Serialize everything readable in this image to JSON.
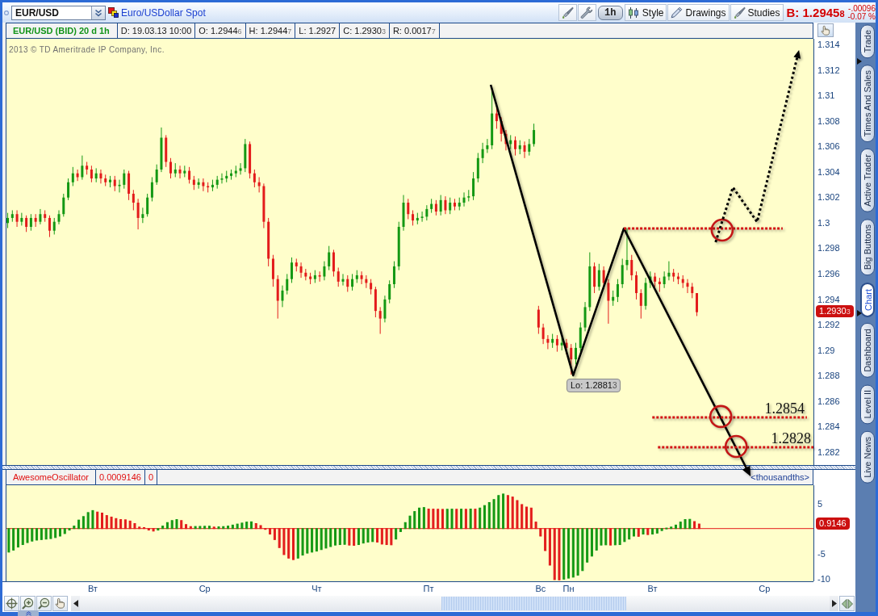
{
  "toolbar": {
    "symbol": "EUR/USD",
    "description": "Euro/USDollar Spot",
    "buttons": [
      {
        "kind": "interval",
        "label": "1h"
      },
      {
        "kind": "menu",
        "label": "Style"
      },
      {
        "kind": "menu",
        "label": "Drawings"
      },
      {
        "kind": "menu",
        "label": "Studies"
      }
    ],
    "bid": {
      "text": "B: 1.2945",
      "pipette": "8"
    },
    "change": "-.00096",
    "change_percent": "-0.07 %"
  },
  "price_panel": {
    "header": [
      {
        "kind": "title",
        "text": "EUR/USD (BID) 20 d 1h"
      },
      {
        "kind": "field",
        "text": "D: 19.03.13 10:00"
      },
      {
        "kind": "field",
        "text": "O: 1.2944",
        "pipette": "6"
      },
      {
        "kind": "field",
        "text": "H: 1.2944",
        "pipette": "7"
      },
      {
        "kind": "field",
        "text": "L: 1.2927"
      },
      {
        "kind": "field",
        "text": "C: 1.2930",
        "pipette": "3"
      },
      {
        "kind": "field",
        "text": "R: 0.0017",
        "pipette": "7"
      }
    ],
    "copyright": "2013 © TD Ameritrade IP Company, Inc.",
    "price_axis": [
      "1.314",
      "1.312",
      "1.31",
      "1.308",
      "1.306",
      "1.304",
      "1.302",
      "1.3",
      "1.298",
      "1.296",
      "1.294",
      "1.292",
      "1.29",
      "1.288",
      "1.286",
      "1.284",
      "1.282"
    ],
    "last_price": {
      "text": "1.2930",
      "pipette": "3"
    },
    "low_label": {
      "text": "Lo: 1.2881",
      "pipette": "3"
    },
    "level_labels": [
      "1.2854",
      "1.2828"
    ]
  },
  "oscillator_panel": {
    "values": [
      "0.0009146",
      "0"
    ],
    "units": "<thousandths>",
    "last_value": "0.9146",
    "chart_data": {
      "type": "bar",
      "categories": [
        null,
        null,
        null,
        null,
        null,
        null,
        null,
        null,
        null,
        null,
        null,
        null,
        null,
        null,
        null,
        null,
        null,
        null,
        "Вт",
        null,
        null,
        null,
        null,
        null,
        null,
        null,
        null,
        null,
        null,
        null,
        null,
        null,
        null,
        null,
        null,
        null,
        null,
        null,
        null,
        null,
        null,
        null,
        "Ср",
        null,
        null,
        null,
        null,
        null,
        null,
        null,
        null,
        null,
        null,
        null,
        null,
        null,
        null,
        null,
        null,
        null,
        null,
        null,
        null,
        null,
        null,
        null,
        "Чт",
        null,
        null,
        null,
        null,
        null,
        null,
        null,
        null,
        null,
        null,
        null,
        null,
        null,
        null,
        null,
        null,
        null,
        null,
        null,
        null,
        null,
        null,
        null,
        "Пт",
        null,
        null,
        null,
        null,
        null,
        null,
        null,
        null,
        null,
        null,
        null,
        null,
        null,
        null,
        null,
        null,
        null,
        null,
        null,
        null,
        null,
        null,
        null,
        "Вс",
        null,
        null,
        null,
        null,
        null,
        "Пн",
        null,
        null,
        null,
        null,
        null,
        null,
        null,
        null,
        null,
        null,
        null,
        null,
        null,
        null,
        null,
        null,
        null,
        "Вт",
        null,
        null,
        null,
        null,
        null,
        null,
        null,
        null,
        null,
        null,
        null,
        null,
        null,
        null,
        null,
        null,
        null,
        null,
        null,
        null,
        null,
        null,
        null,
        "Ср",
        null,
        null,
        null,
        null,
        null,
        null,
        null,
        null,
        null,
        null
      ],
      "ylim": [
        -10.53,
        8.66
      ],
      "yticks": [
        5,
        -5,
        -10
      ],
      "ref_lines": [
        {
          "axis": "y",
          "value": 0
        }
      ],
      "series": [
        {
          "name": "AwesomeOscillator",
          "values": [
            -4.7,
            -4.3,
            -3.7,
            -3.2,
            -2.8,
            -2.5,
            -2.3,
            -2.2,
            -2.1,
            -2.0,
            -1.8,
            -1.5,
            -1.0,
            -0.3,
            0.5,
            1.7,
            2.4,
            3.2,
            3.6,
            3.3,
            3.1,
            2.6,
            2.3,
            2.0,
            1.8,
            1.75,
            1.5,
            1.0,
            0.3,
            0.2,
            -0.3,
            -0.5,
            -0.3,
            0.5,
            1.2,
            1.6,
            1.8,
            1.6,
            0.8,
            0.4,
            0.42,
            0.44,
            0.46,
            0.48,
            0.3,
            0.35,
            0.4,
            0.5,
            0.7,
            0.9,
            1.1,
            1.3,
            1.35,
            1.0,
            0.6,
            0.0,
            -1.1,
            -2.2,
            -3.8,
            -5.2,
            -5.9,
            -6.2,
            -5.9,
            -5.3,
            -4.9,
            -4.7,
            -4.5,
            -4.2,
            -3.9,
            -3.6,
            -3.3,
            -3.2,
            -3.15,
            -3.3,
            -3.35,
            -3.2,
            -2.9,
            -2.7,
            -2.6,
            -2.7,
            -3.1,
            -3.2,
            -3.25,
            -2.1,
            -0.6,
            1.2,
            2.5,
            3.4,
            4.1,
            4.2,
            3.9,
            3.88,
            3.86,
            3.84,
            3.86,
            3.88,
            3.86,
            3.88,
            3.86,
            3.9,
            3.88,
            4.1,
            4.6,
            5.2,
            5.8,
            6.6,
            6.9,
            6.6,
            6.3,
            5.6,
            4.8,
            4.3,
            4.1,
            1.3,
            -1.5,
            -4.4,
            -7.3,
            -10.2,
            -10.25,
            -10.1,
            -9.9,
            -9.7,
            -9.3,
            -8.4,
            -6.7,
            -5.5,
            -4.3,
            -3.3,
            -3.25,
            -3.3,
            -3.25,
            -3.2,
            -2.6,
            -2.1,
            -1.5,
            -1.55,
            -1.1,
            -1.2,
            -1.1,
            -0.9,
            -0.4,
            0.1,
            0.3,
            0.7,
            1.3,
            1.8,
            1.85,
            1.4,
            0.91,
            null,
            null,
            null,
            null,
            null,
            null,
            null,
            null,
            null,
            null,
            null,
            null,
            null,
            null,
            null,
            null,
            null,
            null,
            null,
            null,
            null,
            null,
            null,
            null
          ]
        }
      ]
    }
  },
  "side_tabs": [
    {
      "label": "Trade",
      "selected": false
    },
    {
      "label": "Times And Sales",
      "selected": false
    },
    {
      "label": "Active Trader",
      "selected": false
    },
    {
      "label": "Big Buttons",
      "selected": false
    },
    {
      "label": "Chart",
      "selected": true
    },
    {
      "label": "Dashboard",
      "selected": false
    },
    {
      "label": "Level II",
      "selected": false
    },
    {
      "label": "Live News",
      "selected": false
    }
  ]
}
